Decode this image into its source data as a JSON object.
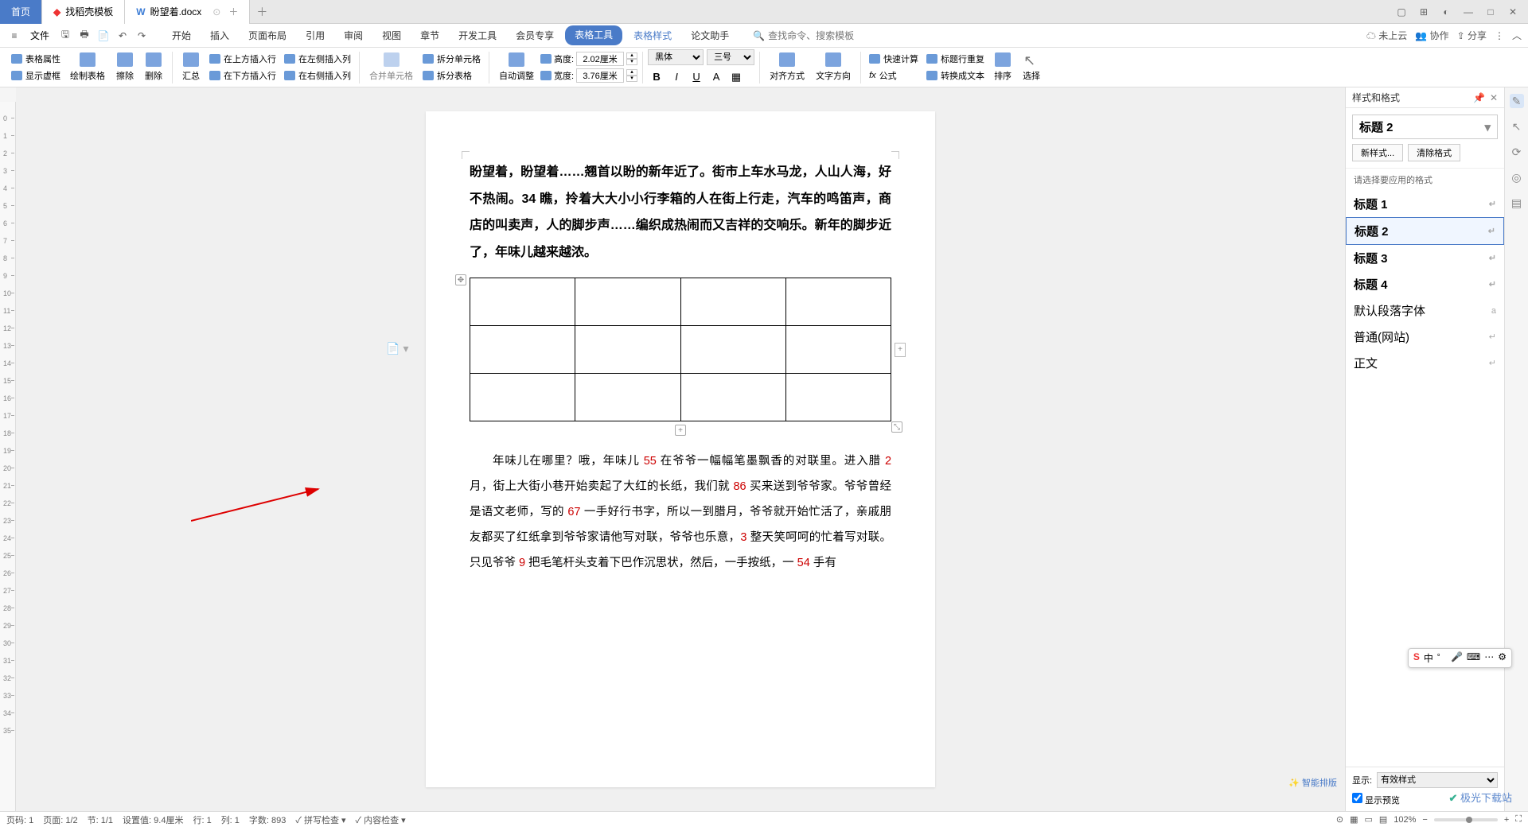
{
  "titlebar": {
    "home_tab": "首页",
    "template_tab": "找稻壳模板",
    "doc_tab": "盼望着.docx"
  },
  "menubar": {
    "file": "文件",
    "items": [
      "开始",
      "插入",
      "页面布局",
      "引用",
      "审阅",
      "视图",
      "章节",
      "开发工具",
      "会员专享",
      "表格工具",
      "表格样式",
      "论文助手"
    ],
    "search_placeholder": "查找命令、搜索模板",
    "cloud": "未上云",
    "collab": "协作",
    "share": "分享"
  },
  "ribbon": {
    "table_props": "表格属性",
    "show_frame": "显示虚框",
    "draw_table": "绘制表格",
    "erase": "擦除",
    "delete": "删除",
    "summary": "汇总",
    "insert_above": "在上方插入行",
    "insert_below": "在下方插入行",
    "insert_left": "在左侧插入列",
    "insert_right": "在右侧插入列",
    "merge_cells": "合并单元格",
    "split_cells": "拆分单元格",
    "split_table": "拆分表格",
    "auto_adjust": "自动调整",
    "row_h_label": "高度:",
    "row_h_value": "2.02厘米",
    "col_w_label": "宽度:",
    "col_w_value": "3.76厘米",
    "font_name": "黑体",
    "font_size": "三号",
    "align": "对齐方式",
    "text_dir": "文字方向",
    "formula": "公式",
    "quick_calc": "快速计算",
    "repeat_header": "标题行重复",
    "to_text": "转换成文本",
    "sort": "排序",
    "select": "选择"
  },
  "doc": {
    "para1": "盼望着，盼望着……翘首以盼的新年近了。街市上车水马龙，人山人海，好不热闹。34 瞧，拎着大大小小行李箱的人在街上行走，汽车的鸣笛声，商店的叫卖声，人的脚步声……编织成热闹而又吉祥的交响乐。新年的脚步近了，年味儿越来越浓。",
    "para2_a": "年味儿在哪里？哦，年味儿 ",
    "para2_b": " 在爷爷一幅幅笔墨飘香的对联里。进入腊 ",
    "para2_c": " 月，街上大街小巷开始卖起了大红的长纸，我们就 ",
    "para2_d": " 买来送到爷爷家。爷爷曾经是语文老师，写的 ",
    "para2_e": " 一手好行书字，所以一到腊月，爷爷就开始忙活了，亲戚朋友都买了红纸拿到爷爷家请他写对联，爷爷也乐意，",
    "para2_f": " 整天笑呵呵的忙着写对联。只见爷爷 ",
    "para2_g": " 把毛笔杆头支着下巴作沉思状，然后，一手按纸，一 ",
    "para2_h": " 手有",
    "n55": "55",
    "n2": "2",
    "n86": "86",
    "n67": "67",
    "n3": "3",
    "n9": "9",
    "n54": "54"
  },
  "panel": {
    "title": "样式和格式",
    "current_style": "标题 2",
    "new_style": "新样式...",
    "clear_format": "清除格式",
    "apply_label": "请选择要应用的格式",
    "styles": [
      "标题 1",
      "标题 2",
      "标题 3",
      "标题 4",
      "默认段落字体",
      "普通(网站)",
      "正文"
    ],
    "show_label": "显示:",
    "show_value": "有效样式",
    "preview_check": "显示预览"
  },
  "statusbar": {
    "page_no": "页码: 1",
    "page": "页面: 1/2",
    "section": "节: 1/1",
    "pos": "设置值: 9.4厘米",
    "line": "行: 1",
    "col": "列: 1",
    "chars": "字数: 893",
    "spell": "拼写检查",
    "content": "内容检查",
    "zoom": "102%",
    "smart_layout": "智能排版"
  },
  "ime": {
    "items": [
      "中",
      "゜",
      "",
      "⌨",
      "…",
      ""
    ]
  },
  "watermark": "极光下载站"
}
